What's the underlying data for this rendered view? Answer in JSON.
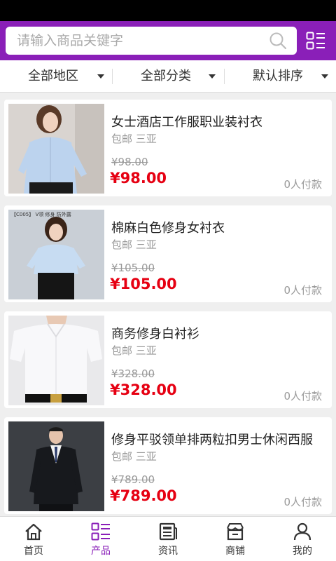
{
  "search": {
    "placeholder": "请输入商品关键字"
  },
  "filters": [
    {
      "label": "全部地区"
    },
    {
      "label": "全部分类"
    },
    {
      "label": "默认排序"
    }
  ],
  "products": [
    {
      "title": "女士酒店工作服职业装衬衣",
      "meta": "包邮 三亚",
      "old_price": "¥98.00",
      "price": "¥98.00",
      "sold": "0人付款"
    },
    {
      "title": "棉麻白色修身女衬衣",
      "meta": "包邮 三亚",
      "old_price": "¥105.00",
      "price": "¥105.00",
      "sold": "0人付款",
      "image_text": "【C005】 V领 修身 防外露"
    },
    {
      "title": "商务修身白衬衫",
      "meta": "包邮 三亚",
      "old_price": "¥328.00",
      "price": "¥328.00",
      "sold": "0人付款"
    },
    {
      "title": "修身平驳领单排两粒扣男士休闲西服",
      "meta": "包邮 三亚",
      "old_price": "¥789.00",
      "price": "¥789.00",
      "sold": "0人付款"
    }
  ],
  "tabs": [
    {
      "label": "首页",
      "icon": "home-icon"
    },
    {
      "label": "产品",
      "icon": "list-icon",
      "active": true
    },
    {
      "label": "资讯",
      "icon": "news-icon"
    },
    {
      "label": "商铺",
      "icon": "store-icon"
    },
    {
      "label": "我的",
      "icon": "user-icon"
    }
  ],
  "colors": {
    "accent": "#8a1fb8",
    "price": "#e60012"
  }
}
